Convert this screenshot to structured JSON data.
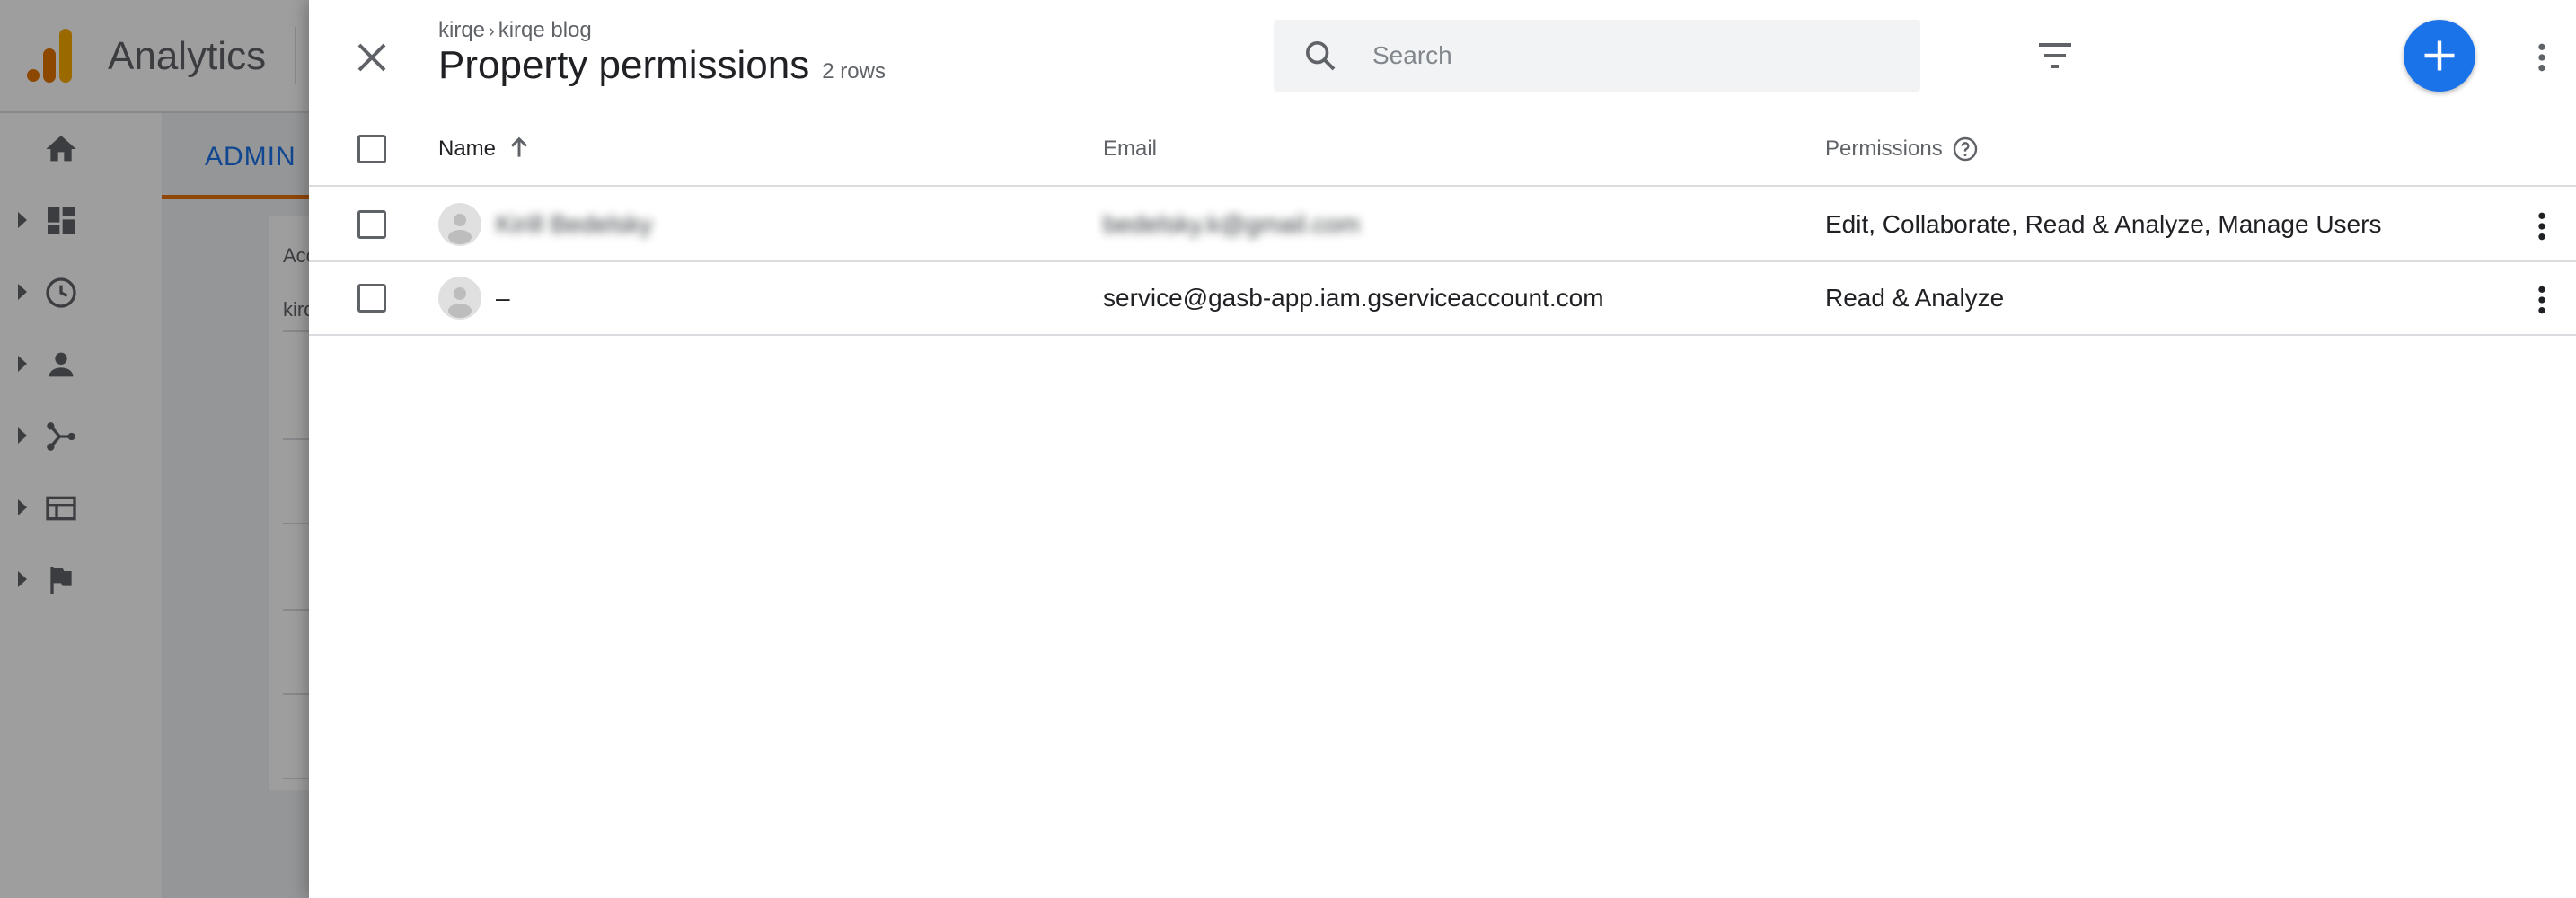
{
  "app": {
    "title": "Analytics",
    "admin_tab": "ADMIN",
    "bg_card_label": "Acc",
    "bg_card_value": "kirq",
    "nav_icons": [
      "home-icon",
      "dashboard-icon",
      "clock-icon",
      "person-icon",
      "share-icon",
      "table-icon",
      "flag-icon"
    ]
  },
  "panel": {
    "breadcrumb": {
      "account": "kirqe",
      "separator": "›",
      "property": "kirqe blog"
    },
    "title": "Property permissions",
    "row_count": "2 rows",
    "search": {
      "placeholder": "Search",
      "value": ""
    },
    "columns": {
      "name": "Name",
      "email": "Email",
      "permissions": "Permissions"
    },
    "rows": [
      {
        "name": "Kirill Bedelsky",
        "email": "bedelsky.k@gmail.com",
        "permissions": "Edit, Collaborate, Read & Analyze, Manage Users",
        "redacted": true
      },
      {
        "name": "–",
        "email": "service@gasb-app.iam.gserviceaccount.com",
        "permissions": "Read & Analyze",
        "redacted": false
      }
    ]
  },
  "colors": {
    "accent": "#1a73e8",
    "admin_underline": "#e8710a",
    "logo_dark": "#e37400",
    "logo_light": "#f9ab00",
    "scrim": "rgba(0,0,0,0.38)"
  }
}
